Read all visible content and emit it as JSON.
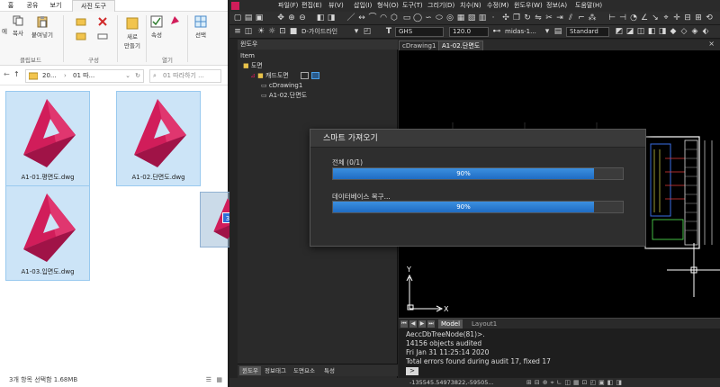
{
  "explorer": {
    "tabs": [
      "홈",
      "공유",
      "보기",
      "사진 도구"
    ],
    "ribbon": {
      "clipboard_buttons": [
        "에",
        "복사",
        "붙여넣기"
      ],
      "clipboard_group": "클립보드",
      "organize_group": "구성",
      "new_button": "새로 만들기",
      "new_button_line1": "새로",
      "new_button_line2": "만들기",
      "properties_button": "속성",
      "open_group": "열기",
      "select_button": "선택"
    },
    "address": {
      "seg1": "20...",
      "seg2": "01 따...",
      "search_placeholder": "01 따라하기 ..."
    },
    "files": [
      {
        "name": "A1-01.평면도.dwg"
      },
      {
        "name": "A1-02.단면도.dwg"
      },
      {
        "name": "A1-03.입면도.dwg"
      }
    ],
    "drag_count": "3",
    "status": "3개 항목 선택함 1.68MB"
  },
  "cad": {
    "menu": [
      "파일(F)",
      "편집(E)",
      "뷰(V)",
      "삽입(I)",
      "형식(O)",
      "도구(T)",
      "그리기(D)",
      "치수(N)",
      "수정(M)",
      "윈도우(W)",
      "정보(A)",
      "도움말(H)"
    ],
    "toolbar": {
      "guide_layer": "D-가이드라인",
      "text_style": "GHS",
      "text_height": "120.0",
      "dim_style": "midas-1...",
      "plot_style": "Standard"
    },
    "left_panel": {
      "title": "윈도우",
      "item_label": "Item",
      "tree": [
        "도면",
        "캐드도면",
        "cDrawing1",
        "A1-02.단면도"
      ],
      "bottom_tabs": [
        "윈도우",
        "정보태그",
        "도면요소",
        "특성"
      ]
    },
    "doc_tabs": [
      "cDrawing1",
      "A1-02.단면도"
    ],
    "layout_tabs": [
      "Model",
      "Layout1"
    ],
    "command_lines": [
      "AeccDbTreeNode(81)>.",
      "14156 objects audited",
      "Fri Jan 31 11:25:14 2020",
      "Total errors found during audit 17, fixed 17"
    ],
    "status_coords": "-135545.54973822,-59505...",
    "axis": {
      "y": "Y",
      "x": "X"
    }
  },
  "dialog": {
    "title": "스마트 가져오기",
    "total_label": "전체 (0/1)",
    "total_progress": 90,
    "total_pct": "90%",
    "db_label": "데이터베이스 복구...",
    "db_progress": 90,
    "db_pct": "90%"
  },
  "colors": {
    "logo": "#d11d5a",
    "logo_dark": "#a01347",
    "progress": "#2b7ad4",
    "selection": "#cce4f7"
  }
}
